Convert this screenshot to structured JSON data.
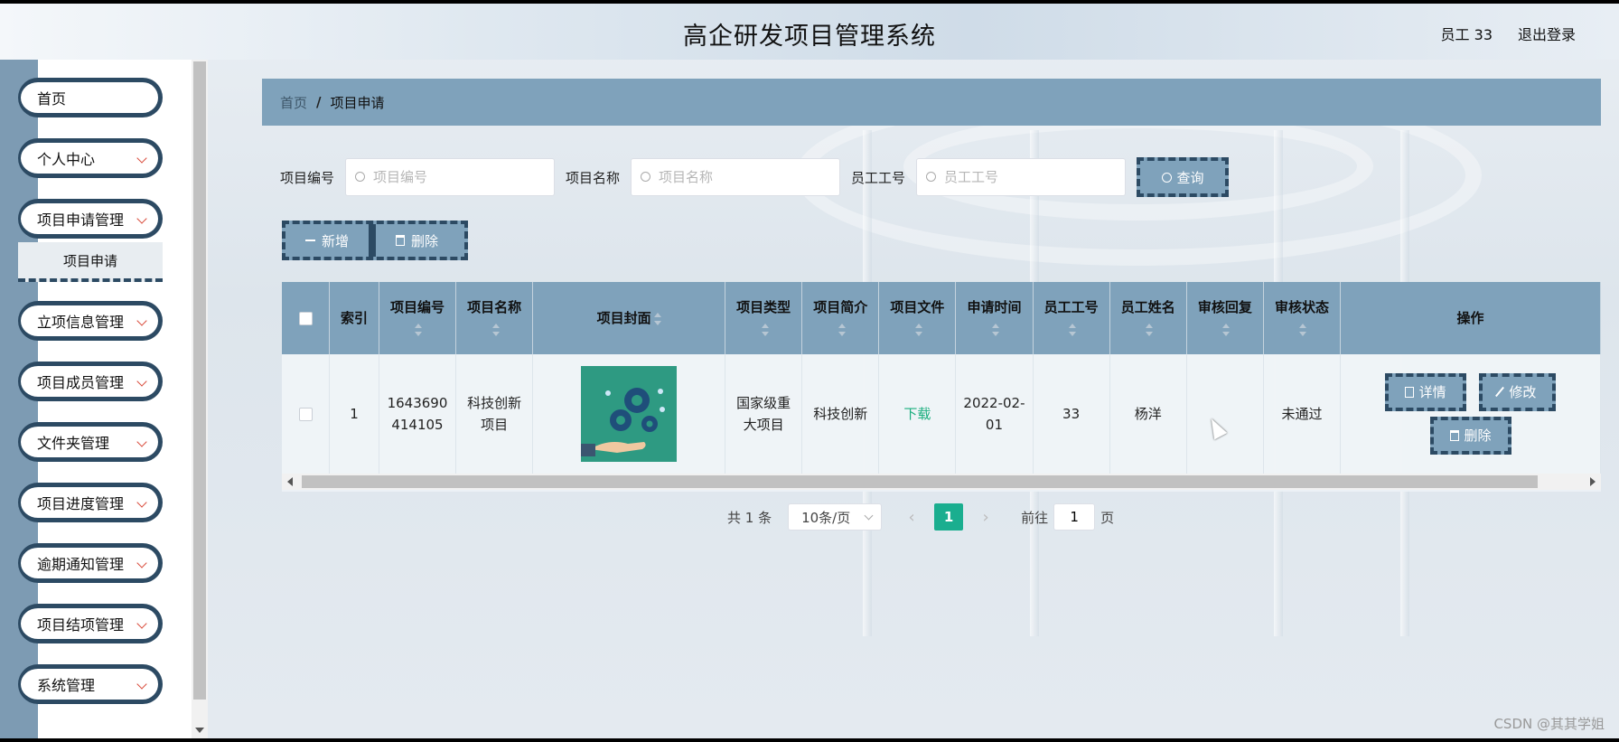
{
  "header": {
    "title": "高企研发项目管理系统",
    "user": "员工 33",
    "logout": "退出登录"
  },
  "sidebar": {
    "items": [
      {
        "label": "首页",
        "has_chevron": false
      },
      {
        "label": "个人中心",
        "has_chevron": true
      },
      {
        "label": "项目申请管理",
        "has_chevron": true
      },
      {
        "label": "立项信息管理",
        "has_chevron": true
      },
      {
        "label": "项目成员管理",
        "has_chevron": true
      },
      {
        "label": "文件夹管理",
        "has_chevron": true
      },
      {
        "label": "项目进度管理",
        "has_chevron": true
      },
      {
        "label": "逾期通知管理",
        "has_chevron": true
      },
      {
        "label": "项目结项管理",
        "has_chevron": true
      },
      {
        "label": "系统管理",
        "has_chevron": true
      }
    ],
    "active_subitem": "项目申请"
  },
  "breadcrumb": {
    "home": "首页",
    "separator": "/",
    "current": "项目申请"
  },
  "search": {
    "fields": [
      {
        "label": "项目编号",
        "placeholder": "项目编号",
        "value": ""
      },
      {
        "label": "项目名称",
        "placeholder": "项目名称",
        "value": ""
      },
      {
        "label": "员工工号",
        "placeholder": "员工工号",
        "value": ""
      }
    ],
    "query_label": "查询"
  },
  "actions": {
    "add_label": "新增",
    "delete_label": "删除"
  },
  "table": {
    "columns": [
      {
        "label": "索引",
        "sortable": false
      },
      {
        "label": "项目编号",
        "sortable": true
      },
      {
        "label": "项目名称",
        "sortable": true
      },
      {
        "label": "项目封面",
        "sortable": true
      },
      {
        "label": "项目类型",
        "sortable": true
      },
      {
        "label": "项目简介",
        "sortable": true
      },
      {
        "label": "项目文件",
        "sortable": true
      },
      {
        "label": "申请时间",
        "sortable": true
      },
      {
        "label": "员工工号",
        "sortable": true
      },
      {
        "label": "员工姓名",
        "sortable": true
      },
      {
        "label": "审核回复",
        "sortable": true
      },
      {
        "label": "审核状态",
        "sortable": true
      },
      {
        "label": "操作",
        "sortable": false
      }
    ],
    "rows": [
      {
        "index": "1",
        "project_no": "1643690414105",
        "project_name": "科技创新项目",
        "project_type": "国家级重大项目",
        "project_intro": "科技创新",
        "project_file": "下载",
        "apply_time": "2022-02-01",
        "staff_no": "33",
        "staff_name": "杨洋",
        "review_reply": "",
        "review_status": "未通过",
        "ops": {
          "detail": "详情",
          "edit": "修改",
          "delete": "删除"
        }
      }
    ]
  },
  "pagination": {
    "total_text": "共 1 条",
    "page_size": "10条/页",
    "current_page": "1",
    "goto_label": "前往",
    "goto_value": "1",
    "page_suffix": "页"
  },
  "watermark": "CSDN @其其学姐",
  "colors": {
    "accent": "#7fa2bb",
    "border_dark": "#2c4a63",
    "success": "#1aae8f"
  }
}
